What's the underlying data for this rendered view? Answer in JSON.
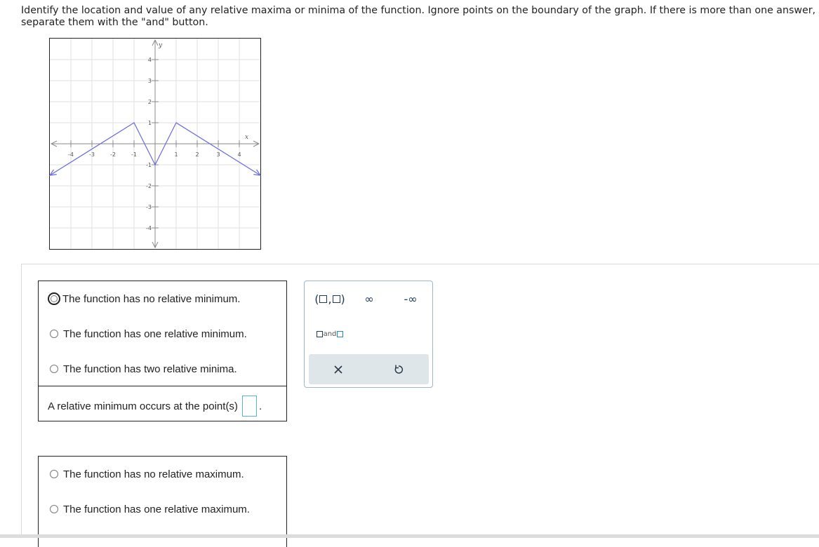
{
  "question": {
    "text": "Identify the location and value of any relative maxima or minima of the function. Ignore points on the boundary of the graph. If there is more than one answer, separate them with the \"and\" button."
  },
  "graph": {
    "x_axis_label": "x",
    "y_axis_label": "y",
    "x_ticks": [
      "-4",
      "-3",
      "-2",
      "-1",
      "1",
      "2",
      "3",
      "4"
    ],
    "y_ticks": [
      "4",
      "3",
      "2",
      "1",
      "-1",
      "-2",
      "-3",
      "-4"
    ],
    "xlim": [
      -5,
      5
    ],
    "ylim": [
      -5,
      5
    ],
    "grid": true,
    "curve_points": [
      [
        -5,
        -1.5
      ],
      [
        -1,
        1
      ],
      [
        0,
        -1
      ],
      [
        1,
        1
      ],
      [
        5,
        -1.5
      ]
    ],
    "curve_color": "#6a6ae0"
  },
  "minimum_question": {
    "options": [
      "The function has no relative minimum.",
      "The function has one relative minimum.",
      "The function has two relative minima."
    ],
    "answer_prompt": "A relative minimum occurs at the point(s)",
    "answer_suffix": "."
  },
  "maximum_question": {
    "options": [
      "The function has no relative maximum.",
      "The function has one relative maximum."
    ]
  },
  "palette": {
    "interval_open": "(",
    "interval_comma": ",",
    "interval_close": ")",
    "infinity": "∞",
    "neg_infinity": "-∞",
    "and_label": "and",
    "accent_color": "#1e8ac8"
  }
}
